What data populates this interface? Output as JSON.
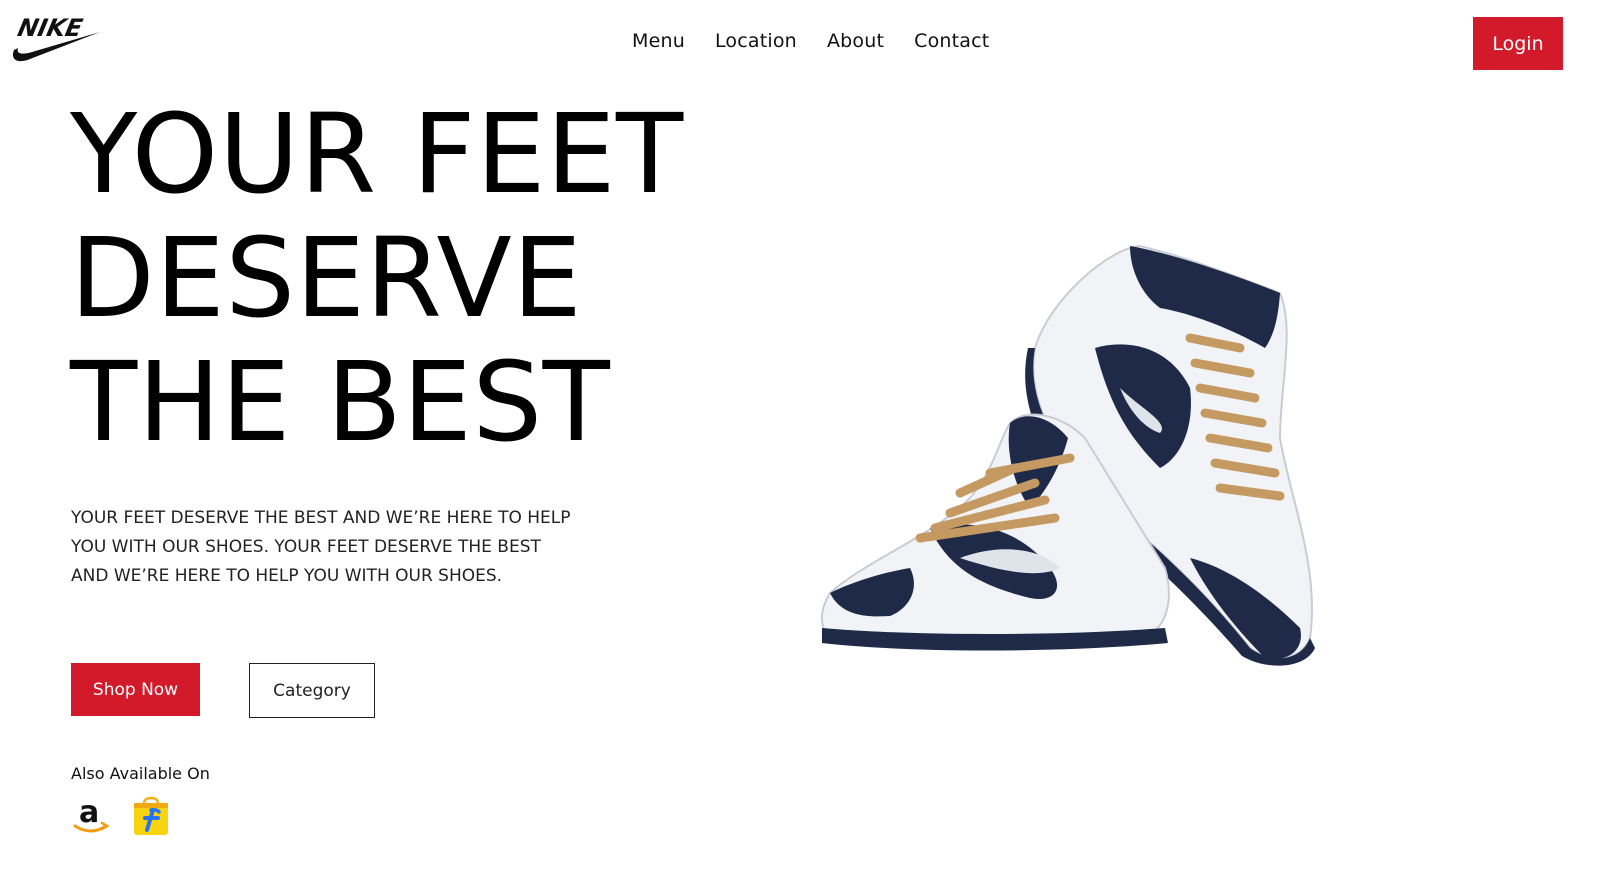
{
  "header": {
    "brand": "NIKE",
    "nav": [
      "Menu",
      "Location",
      "About",
      "Contact"
    ],
    "login_label": "Login"
  },
  "hero": {
    "title_lines": [
      "YOUR FEET",
      "DESERVE",
      "THE BEST"
    ],
    "description": "YOUR FEET DESERVE THE BEST AND WE’RE HERE TO HELP YOU WITH OUR SHOES. YOUR FEET DESERVE THE BEST AND WE’RE HERE TO HELP YOU WITH OUR SHOES.",
    "shop_label": "Shop Now",
    "category_label": "Category",
    "available_label": "Also Available On",
    "stores": [
      "amazon-icon",
      "flipkart-icon"
    ]
  },
  "colors": {
    "accent": "#d31a2b",
    "shoe_navy": "#1f2a48",
    "lace": "#c49a62"
  }
}
